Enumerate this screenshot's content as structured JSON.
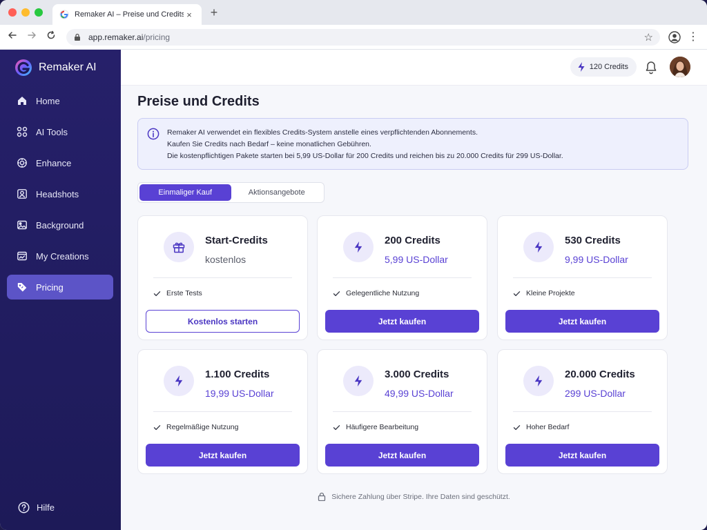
{
  "browser": {
    "tab_title": "Remaker AI – Preise und Credits",
    "tab_close": "×",
    "new_tab": "+",
    "url_host": "app.remaker.ai",
    "url_path": "/pricing"
  },
  "sidebar": {
    "brand": "Remaker AI",
    "items": [
      {
        "label": "Home",
        "icon": "home-icon"
      },
      {
        "label": "AI Tools",
        "icon": "tools-grid-icon"
      },
      {
        "label": "Enhance",
        "icon": "enhance-icon"
      },
      {
        "label": "Headshots",
        "icon": "headshot-icon"
      },
      {
        "label": "Background",
        "icon": "image-background-icon"
      },
      {
        "label": "My Creations",
        "icon": "creations-icon"
      },
      {
        "label": "Pricing",
        "icon": "price-tag-icon",
        "active": true
      }
    ],
    "help_label": "Hilfe"
  },
  "topbar": {
    "credits": "120 Credits"
  },
  "page": {
    "title": "Preise und Credits",
    "info_lines": [
      "Remaker AI verwendet ein flexibles Credits-System anstelle eines verpflichtenden Abonnements.",
      "Kaufen Sie Credits nach Bedarf – keine monatlichen Gebühren.",
      "Die kostenpflichtigen Pakete starten bei 5,99 US-Dollar für 200 Credits und reichen bis zu 20.000 Credits für 299 US-Dollar."
    ],
    "segments": [
      "Einmaliger Kauf",
      "Aktionsangebote"
    ],
    "active_segment": "Einmaliger Kauf",
    "plans": [
      {
        "name": "Start-Credits",
        "price": "kostenlos",
        "feature": "Erste Tests",
        "button": "Kostenlos starten",
        "icon": "gift-icon"
      },
      {
        "name": "200 Credits",
        "price": "5,99 US-Dollar",
        "feature": "Gelegentliche Nutzung",
        "button": "Jetzt kaufen",
        "icon": "bolt-icon"
      },
      {
        "name": "530 Credits",
        "price": "9,99 US-Dollar",
        "feature": "Kleine Projekte",
        "button": "Jetzt kaufen",
        "icon": "bolt-icon"
      },
      {
        "name": "1.100 Credits",
        "price": "19,99 US-Dollar",
        "feature": "Regelmäßige Nutzung",
        "button": "Jetzt kaufen",
        "icon": "bolt-icon"
      },
      {
        "name": "3.000 Credits",
        "price": "49,99 US-Dollar",
        "feature": "Häufigere Bearbeitung",
        "button": "Jetzt kaufen",
        "icon": "bolt-icon"
      },
      {
        "name": "20.000 Credits",
        "price": "299 US-Dollar",
        "feature": "Hoher Bedarf",
        "button": "Jetzt kaufen",
        "icon": "bolt-icon"
      }
    ],
    "secure_note": "Sichere Zahlung über Stripe. Ihre Daten sind geschützt."
  },
  "colors": {
    "accent": "#5941d4",
    "sidebar_bg": "#26206a",
    "sidebar_active": "#5c54c7",
    "info_bg": "#eef0fd"
  }
}
